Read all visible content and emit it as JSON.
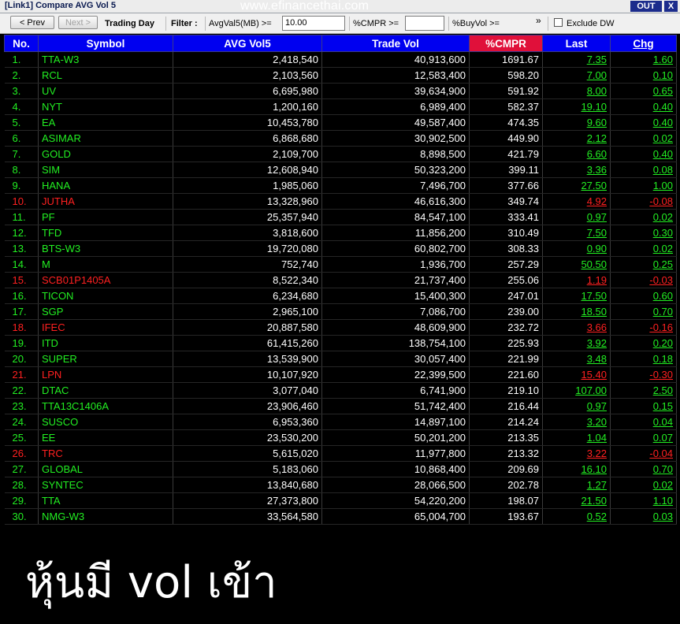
{
  "window": {
    "title": "[Link1] Compare AVG Vol 5",
    "watermark": "www.efinancethai.com",
    "out_label": "OUT",
    "close_label": "X"
  },
  "toolbar": {
    "prev_label": "< Prev",
    "next_label": "Next >",
    "trading_day_label": "Trading Day",
    "filter_label": "Filter :",
    "avgvol_label": "AvgVal5(MB) >=",
    "avgvol_value": "10.00",
    "cmpr_label": "%CMPR >=",
    "cmpr_value": "",
    "buyvol_label": "%BuyVol >=",
    "more_label": "»",
    "exclude_dw_label": "Exclude DW"
  },
  "table": {
    "headers": [
      "No.",
      "Symbol",
      "AVG Vol5",
      "Trade Vol",
      "%CMPR",
      "Last",
      "Chg"
    ],
    "rows": [
      {
        "no": "1.",
        "symbol": "TTA-W3",
        "avg": "2,418,540",
        "trade": "40,913,600",
        "cmpr": "1691.67",
        "last": "7.35",
        "chg": "1.60",
        "dir": "up"
      },
      {
        "no": "2.",
        "symbol": "RCL",
        "avg": "2,103,560",
        "trade": "12,583,400",
        "cmpr": "598.20",
        "last": "7.00",
        "chg": "0.10",
        "dir": "up"
      },
      {
        "no": "3.",
        "symbol": "UV",
        "avg": "6,695,980",
        "trade": "39,634,900",
        "cmpr": "591.92",
        "last": "8.00",
        "chg": "0.65",
        "dir": "up"
      },
      {
        "no": "4.",
        "symbol": "NYT",
        "avg": "1,200,160",
        "trade": "6,989,400",
        "cmpr": "582.37",
        "last": "19.10",
        "chg": "0.40",
        "dir": "up"
      },
      {
        "no": "5.",
        "symbol": "EA",
        "avg": "10,453,780",
        "trade": "49,587,400",
        "cmpr": "474.35",
        "last": "9.60",
        "chg": "0.40",
        "dir": "up"
      },
      {
        "no": "6.",
        "symbol": "ASIMAR",
        "avg": "6,868,680",
        "trade": "30,902,500",
        "cmpr": "449.90",
        "last": "2.12",
        "chg": "0.02",
        "dir": "up"
      },
      {
        "no": "7.",
        "symbol": "GOLD",
        "avg": "2,109,700",
        "trade": "8,898,500",
        "cmpr": "421.79",
        "last": "6.60",
        "chg": "0.40",
        "dir": "up"
      },
      {
        "no": "8.",
        "symbol": "SIM",
        "avg": "12,608,940",
        "trade": "50,323,200",
        "cmpr": "399.11",
        "last": "3.36",
        "chg": "0.08",
        "dir": "up"
      },
      {
        "no": "9.",
        "symbol": "HANA",
        "avg": "1,985,060",
        "trade": "7,496,700",
        "cmpr": "377.66",
        "last": "27.50",
        "chg": "1.00",
        "dir": "up"
      },
      {
        "no": "10.",
        "symbol": "JUTHA",
        "avg": "13,328,960",
        "trade": "46,616,300",
        "cmpr": "349.74",
        "last": "4.92",
        "chg": "-0.08",
        "dir": "dn"
      },
      {
        "no": "11.",
        "symbol": "PF",
        "avg": "25,357,940",
        "trade": "84,547,100",
        "cmpr": "333.41",
        "last": "0.97",
        "chg": "0.02",
        "dir": "up"
      },
      {
        "no": "12.",
        "symbol": "TFD",
        "avg": "3,818,600",
        "trade": "11,856,200",
        "cmpr": "310.49",
        "last": "7.50",
        "chg": "0.30",
        "dir": "up"
      },
      {
        "no": "13.",
        "symbol": "BTS-W3",
        "avg": "19,720,080",
        "trade": "60,802,700",
        "cmpr": "308.33",
        "last": "0.90",
        "chg": "0.02",
        "dir": "up"
      },
      {
        "no": "14.",
        "symbol": "M",
        "avg": "752,740",
        "trade": "1,936,700",
        "cmpr": "257.29",
        "last": "50.50",
        "chg": "0.25",
        "dir": "up"
      },
      {
        "no": "15.",
        "symbol": "SCB01P1405A",
        "avg": "8,522,340",
        "trade": "21,737,400",
        "cmpr": "255.06",
        "last": "1.19",
        "chg": "-0.03",
        "dir": "dn"
      },
      {
        "no": "16.",
        "symbol": "TICON",
        "avg": "6,234,680",
        "trade": "15,400,300",
        "cmpr": "247.01",
        "last": "17.50",
        "chg": "0.60",
        "dir": "up"
      },
      {
        "no": "17.",
        "symbol": "SGP",
        "avg": "2,965,100",
        "trade": "7,086,700",
        "cmpr": "239.00",
        "last": "18.50",
        "chg": "0.70",
        "dir": "up"
      },
      {
        "no": "18.",
        "symbol": "IFEC",
        "avg": "20,887,580",
        "trade": "48,609,900",
        "cmpr": "232.72",
        "last": "3.66",
        "chg": "-0.16",
        "dir": "dn"
      },
      {
        "no": "19.",
        "symbol": "ITD",
        "avg": "61,415,260",
        "trade": "138,754,100",
        "cmpr": "225.93",
        "last": "3.92",
        "chg": "0.20",
        "dir": "up"
      },
      {
        "no": "20.",
        "symbol": "SUPER",
        "avg": "13,539,900",
        "trade": "30,057,400",
        "cmpr": "221.99",
        "last": "3.48",
        "chg": "0.18",
        "dir": "up"
      },
      {
        "no": "21.",
        "symbol": "LPN",
        "avg": "10,107,920",
        "trade": "22,399,500",
        "cmpr": "221.60",
        "last": "15.40",
        "chg": "-0.30",
        "dir": "dn"
      },
      {
        "no": "22.",
        "symbol": "DTAC",
        "avg": "3,077,040",
        "trade": "6,741,900",
        "cmpr": "219.10",
        "last": "107.00",
        "chg": "2.50",
        "dir": "up"
      },
      {
        "no": "23.",
        "symbol": "TTA13C1406A",
        "avg": "23,906,460",
        "trade": "51,742,400",
        "cmpr": "216.44",
        "last": "0.97",
        "chg": "0.15",
        "dir": "up"
      },
      {
        "no": "24.",
        "symbol": "SUSCO",
        "avg": "6,953,360",
        "trade": "14,897,100",
        "cmpr": "214.24",
        "last": "3.20",
        "chg": "0.04",
        "dir": "up"
      },
      {
        "no": "25.",
        "symbol": "EE",
        "avg": "23,530,200",
        "trade": "50,201,200",
        "cmpr": "213.35",
        "last": "1.04",
        "chg": "0.07",
        "dir": "up"
      },
      {
        "no": "26.",
        "symbol": "TRC",
        "avg": "5,615,020",
        "trade": "11,977,800",
        "cmpr": "213.32",
        "last": "3.22",
        "chg": "-0.04",
        "dir": "dn"
      },
      {
        "no": "27.",
        "symbol": "GLOBAL",
        "avg": "5,183,060",
        "trade": "10,868,400",
        "cmpr": "209.69",
        "last": "16.10",
        "chg": "0.70",
        "dir": "up"
      },
      {
        "no": "28.",
        "symbol": "SYNTEC",
        "avg": "13,840,680",
        "trade": "28,066,500",
        "cmpr": "202.78",
        "last": "1.27",
        "chg": "0.02",
        "dir": "up"
      },
      {
        "no": "29.",
        "symbol": "TTA",
        "avg": "27,373,800",
        "trade": "54,220,200",
        "cmpr": "198.07",
        "last": "21.50",
        "chg": "1.10",
        "dir": "up"
      },
      {
        "no": "30.",
        "symbol": "NMG-W3",
        "avg": "33,564,580",
        "trade": "65,004,700",
        "cmpr": "193.67",
        "last": "0.52",
        "chg": "0.03",
        "dir": "up"
      }
    ]
  },
  "caption": "หุ้นมี vol เข้า",
  "colors": {
    "up": "#22ee22",
    "down": "#ff2020",
    "header_bg": "#0000f0",
    "cmpr_header_bg": "#e0103a",
    "background": "#000000"
  }
}
